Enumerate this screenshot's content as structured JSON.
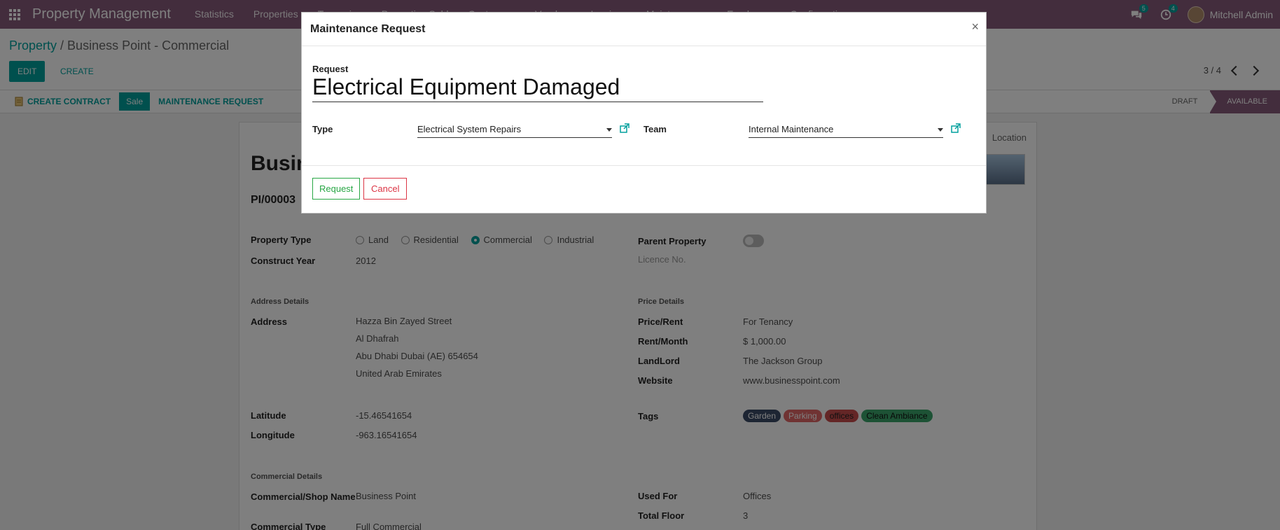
{
  "navbar": {
    "brand": "Property Management",
    "menu": [
      "Statistics",
      "Properties",
      "Tenancies",
      "Properties Sold",
      "Customers",
      "Vendors",
      "Invoices",
      "Maintenances",
      "Employee",
      "Configurations"
    ],
    "chat_badge": "5",
    "activity_badge": "4",
    "user_name": "Mitchell Admin"
  },
  "control_panel": {
    "breadcrumb_root": "Property",
    "breadcrumb_sep": " / ",
    "breadcrumb_current": "Business Point - Commercial",
    "edit_label": "EDIT",
    "create_label": "CREATE",
    "pager": "3 / 4"
  },
  "statusbar": {
    "create_contract": "CREATE CONTRACT",
    "sale": "Sale",
    "maintenance_request": "MAINTENANCE REQUEST",
    "stages": [
      "DRAFT",
      "AVAILABLE"
    ],
    "active_stage": "AVAILABLE"
  },
  "sheet": {
    "location_button": "Location",
    "title": "Business Point",
    "reference": "PI/00003",
    "property_type_label": "Property Type",
    "property_types": [
      "Land",
      "Residential",
      "Commercial",
      "Industrial"
    ],
    "property_type_selected": "Commercial",
    "construct_year_label": "Construct Year",
    "construct_year": "2012",
    "parent_property_label": "Parent Property",
    "licence_label": "Licence No.",
    "address_section": "Address Details",
    "address_label": "Address",
    "address_lines": [
      "Hazza Bin Zayed Street",
      "Al Dhafrah",
      "Abu Dhabi  Dubai (AE)  654654",
      "United Arab Emirates"
    ],
    "latitude_label": "Latitude",
    "latitude": "-15.46541654",
    "longitude_label": "Longitude",
    "longitude": "-963.16541654",
    "price_section": "Price Details",
    "price_rent_label": "Price/Rent",
    "price_rent": "For Tenancy",
    "rent_month_label": "Rent/Month",
    "rent_month": "$ 1,000.00",
    "landlord_label": "LandLord",
    "landlord": "The Jackson Group",
    "website_label": "Website",
    "website": "www.businesspoint.com",
    "tags_label": "Tags",
    "tags": [
      {
        "name": "Garden",
        "color": "#3a4a66"
      },
      {
        "name": "Parking",
        "color": "#e06666"
      },
      {
        "name": "offices",
        "color": "#c94d4d"
      },
      {
        "name": "Clean Ambiance",
        "color": "#3aa46a"
      }
    ],
    "commercial_section": "Commercial Details",
    "commercial_name_label": "Commercial/Shop Name",
    "commercial_name": "Business Point",
    "commercial_type_label": "Commercial Type",
    "commercial_type": "Full Commercial",
    "used_for_label": "Used For",
    "used_for": "Offices",
    "total_floor_label": "Total Floor",
    "total_floor": "3"
  },
  "modal": {
    "title": "Maintenance Request",
    "close": "×",
    "request_label": "Request",
    "request_value": "Electrical Equipment Damaged",
    "type_label": "Type",
    "type_value": "Electrical System Repairs",
    "team_label": "Team",
    "team_value": "Internal Maintenance",
    "request_button": "Request",
    "cancel_button": "Cancel"
  },
  "colors": {
    "brand_purple": "#875a7b",
    "accent_teal": "#00a09d",
    "request_green": "#28a745",
    "cancel_red": "#dc3545"
  }
}
